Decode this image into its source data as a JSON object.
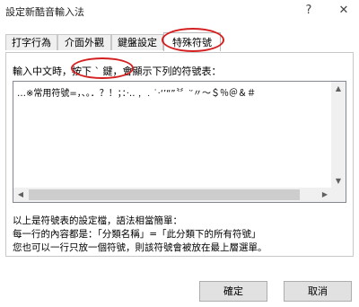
{
  "window": {
    "title": "設定新酷音輸入法",
    "help_label": "?",
    "close_label": "✕"
  },
  "tabs": [
    {
      "label": "打字行為"
    },
    {
      "label": "介面外觀"
    },
    {
      "label": "鍵盤設定"
    },
    {
      "label": "特殊符號"
    }
  ],
  "content": {
    "instruction": "輸入中文時，按下 ` 鍵，會顯示下列的符號表：",
    "symbols_text": "…※常用符號=，、。．？！；：‧‥﹐﹒˙·‘’“”〝〞‵′〃～＄％＠＆＃",
    "desc_line1": "以上是符號表的設定檔，語法相當簡單：",
    "desc_line2": "每一行的內容都是：「分類名稱」=「此分類下的所有符號」",
    "desc_line3": "您也可以一行只放一個符號，則該符號會被放在最上層選單。"
  },
  "buttons": {
    "ok_label": "確定",
    "cancel_label": "取消"
  },
  "icons": {
    "scroll_up": "▲",
    "scroll_down": "▼",
    "scroll_left": "◀",
    "scroll_right": "▶"
  }
}
